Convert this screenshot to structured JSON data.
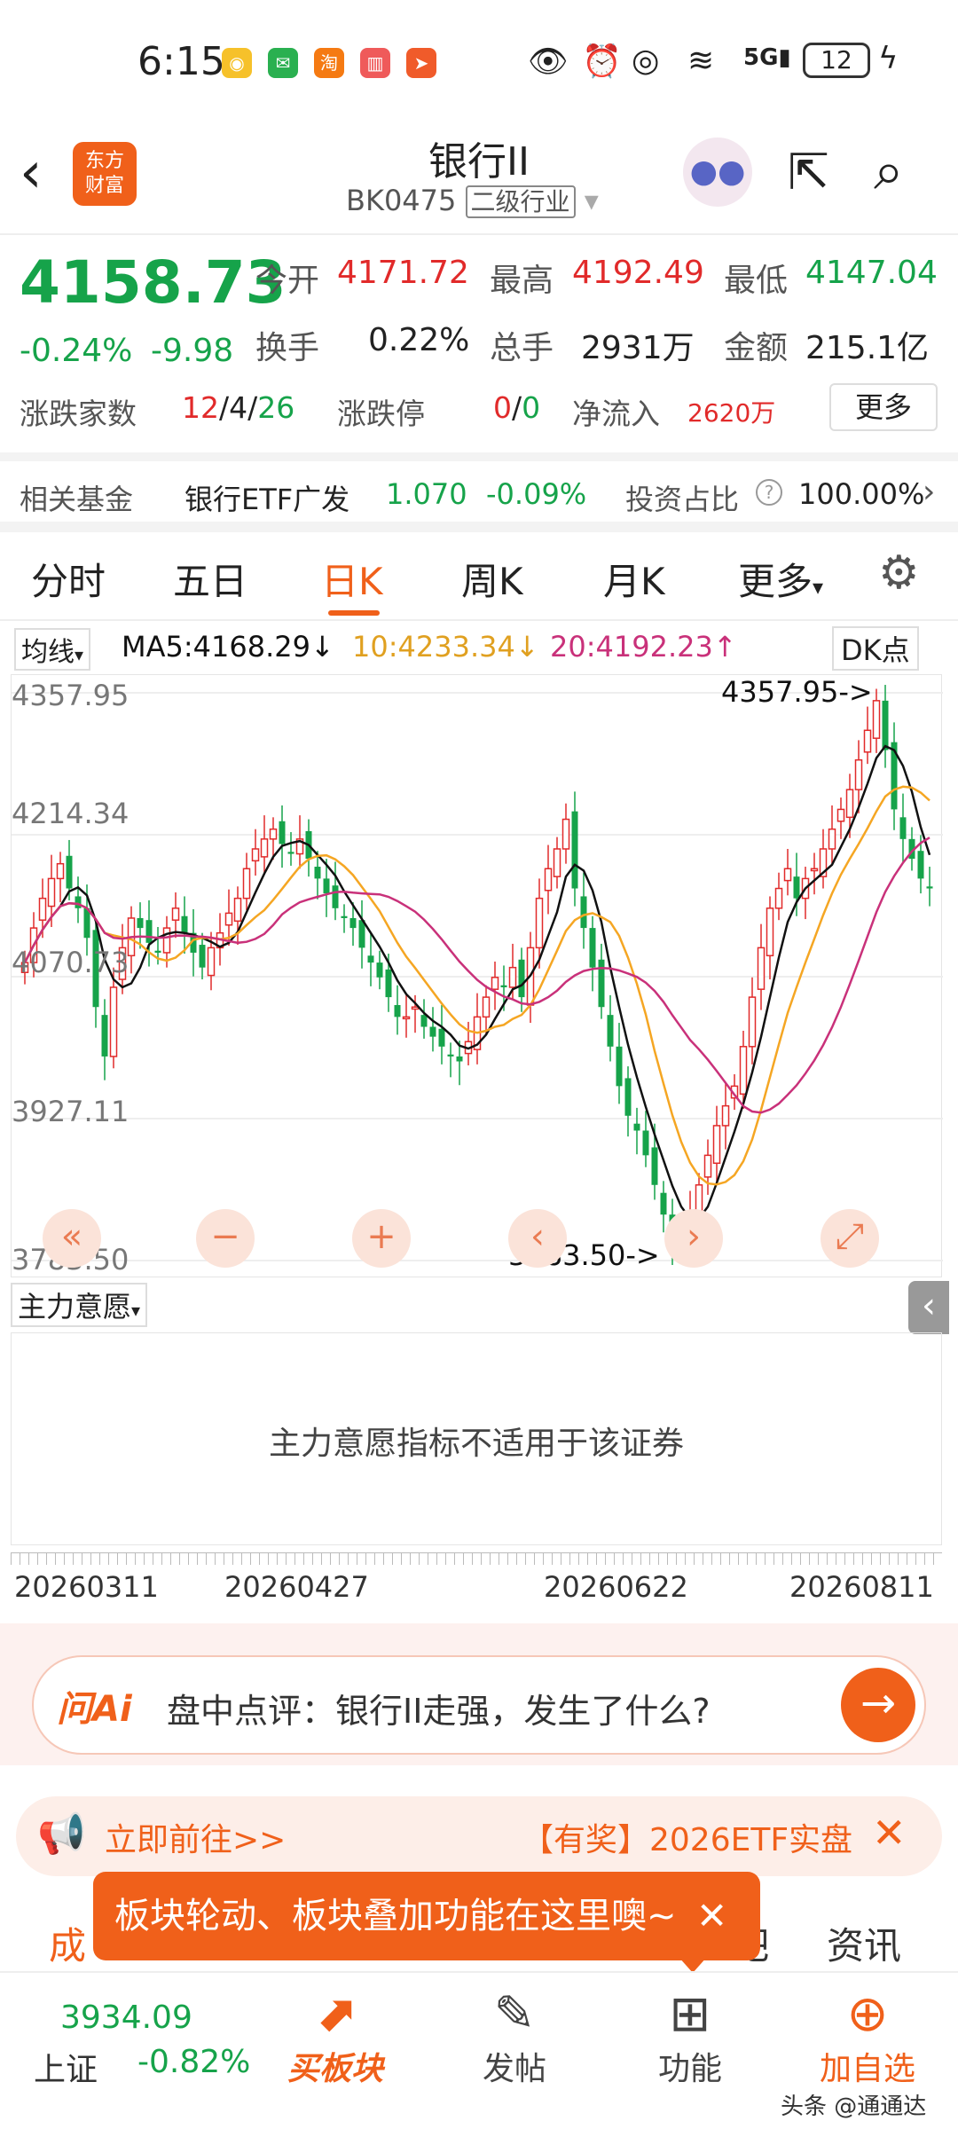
{
  "status_bar": {
    "time": "6:15",
    "battery": "12"
  },
  "header": {
    "title": "银行II",
    "code": "BK0475",
    "tag": "二级行业",
    "logo_line1": "东方",
    "logo_line2": "财富"
  },
  "stats": {
    "price": "4158.73",
    "change_pct": "-0.24%",
    "change": "-9.98",
    "open_label": "今开",
    "open": "4171.72",
    "high_label": "最高",
    "high": "4192.49",
    "low_label": "最低",
    "low": "4147.04",
    "turnover_label": "换手",
    "turnover": "0.22%",
    "volume_label": "总手",
    "volume": "2931万",
    "amount_label": "金额",
    "amount": "215.1亿",
    "breadth_label": "涨跌家数",
    "breadth_up": "12",
    "breadth_flat": "4",
    "breadth_down": "26",
    "limit_label": "涨跌停",
    "limit_up": "0",
    "limit_down": "0",
    "inflow_label": "净流入",
    "inflow": "2620万",
    "more_button": "更多"
  },
  "fund": {
    "label": "相关基金",
    "name": "银行ETF广发",
    "price": "1.070",
    "change": "-0.09%",
    "ratio_label": "投资占比",
    "ratio": "100.00%"
  },
  "tabs": [
    "分时",
    "五日",
    "日K",
    "周K",
    "月K",
    "更多"
  ],
  "active_tab": "日K",
  "ma": {
    "selector": "均线",
    "ma5": "MA5:4168.29",
    "ma10": "10:4233.34",
    "ma20": "20:4192.23",
    "dk_button": "DK点"
  },
  "chart_data": {
    "type": "candlestick",
    "y_ticks": [
      "4357.95",
      "4214.34",
      "4070.73",
      "3927.11",
      "3783.50"
    ],
    "ylim": [
      3783.5,
      4357.95
    ],
    "max_label": "4357.95->",
    "min_label": "3783.50->",
    "x_ticks": [
      "20260311",
      "20260427",
      "20260622",
      "20260811"
    ],
    "closes": [
      4085,
      4120,
      4150,
      4170,
      4185,
      4160,
      4140,
      4110,
      4040,
      3990,
      4060,
      4100,
      4130,
      4120,
      4105,
      4095,
      4120,
      4140,
      4115,
      4095,
      4080,
      4100,
      4115,
      4135,
      4150,
      4180,
      4200,
      4210,
      4220,
      4205,
      4195,
      4210,
      4190,
      4170,
      4155,
      4140,
      4130,
      4120,
      4100,
      4085,
      4070,
      4050,
      4030,
      4030,
      4040,
      4020,
      4010,
      4000,
      3990,
      3985,
      4005,
      4030,
      4050,
      4070,
      4060,
      4080,
      4050,
      4100,
      4150,
      4180,
      4200,
      4230,
      4160,
      4120,
      4080,
      4040,
      4000,
      3960,
      3930,
      3915,
      3890,
      3860,
      3830,
      3800,
      3810,
      3830,
      3860,
      3890,
      3920,
      3940,
      3960,
      4000,
      4050,
      4100,
      4140,
      4160,
      4180,
      4150,
      4170,
      4180,
      4200,
      4220,
      4240,
      4260,
      4290,
      4320,
      4350,
      4300,
      4240,
      4210,
      4190,
      4170,
      4160
    ]
  },
  "indicator": {
    "selector": "主力意愿",
    "message": "主力意愿指标不适用于该证券"
  },
  "ai": {
    "brand": "问Ai",
    "text": "盘中点评：银行II走强，发生了什么?"
  },
  "marquee": {
    "left_text": "立即前往>>",
    "right_text": "【有奖】2026ETF实盘"
  },
  "tooltip": {
    "text": "板块轮动、板块叠加功能在这里噢~"
  },
  "subtabs": {
    "left": "成",
    "right1": "吧",
    "right2": "资讯"
  },
  "bottom": {
    "index_value": "3934.09",
    "index_name": "上证",
    "index_change": "-0.82%",
    "buy_label": "买板块",
    "post_label": "发帖",
    "func_label": "功能",
    "add_label": "加自选"
  },
  "watermark": "头条 @通通达",
  "colors": {
    "up": "#e12a2a",
    "down": "#16a34a",
    "accent": "#f0601a",
    "ma5": "#111111",
    "ma10": "#f5a623",
    "ma20": "#c9317a"
  }
}
